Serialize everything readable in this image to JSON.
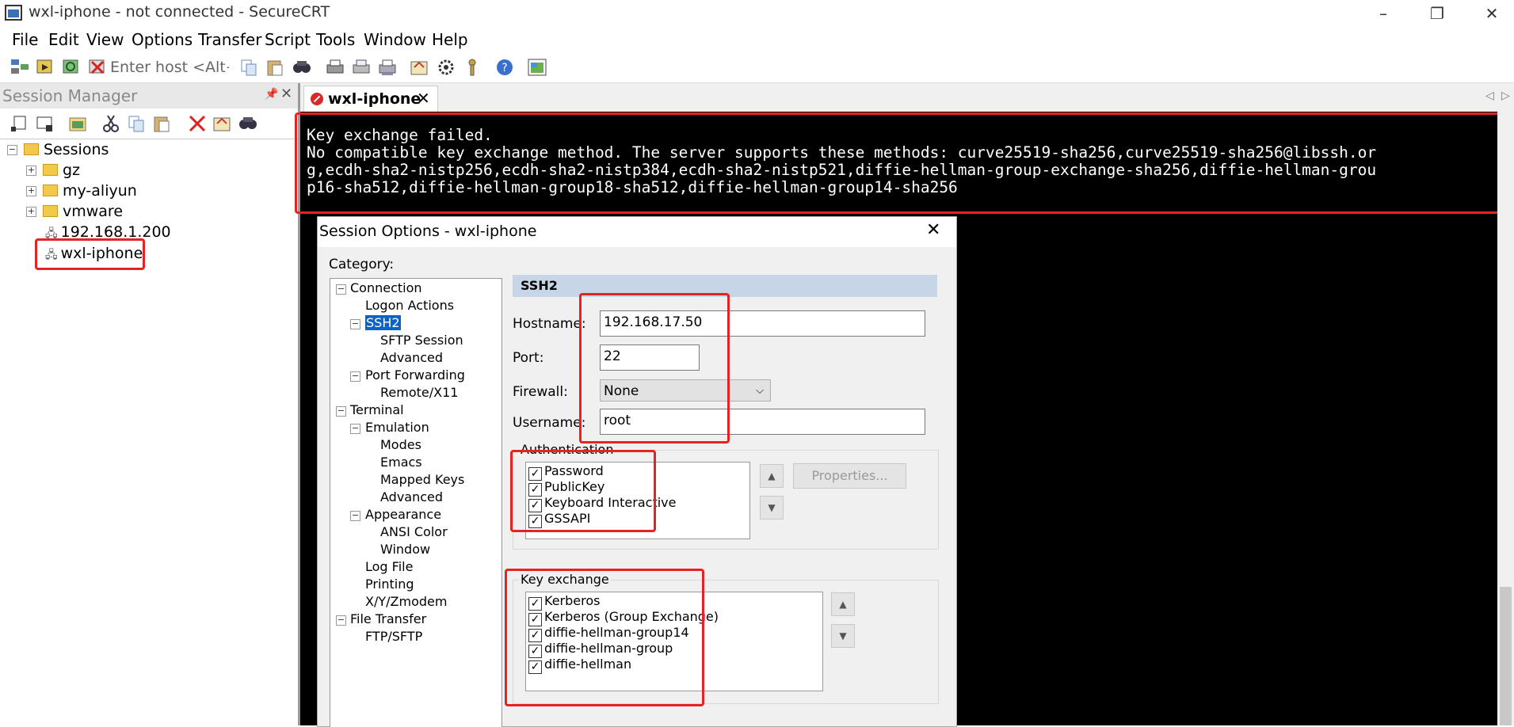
{
  "window": {
    "title": "wxl-iphone - not connected - SecureCRT"
  },
  "menu": [
    "File",
    "Edit",
    "View",
    "Options",
    "Transfer",
    "Script",
    "Tools",
    "Window",
    "Help"
  ],
  "toolbar": {
    "host_placeholder": "Enter host <Alt+"
  },
  "session_manager": {
    "title": "Session Manager",
    "tree": {
      "root": "Sessions",
      "folders": [
        "gz",
        "my-aliyun",
        "vmware"
      ],
      "sessions": [
        "192.168.1.200",
        "wxl-iphone"
      ]
    }
  },
  "tab": {
    "label": "wxl-iphone"
  },
  "terminal": {
    "lines": [
      "Key exchange failed.",
      "No compatible key exchange method. The server supports these methods: curve25519-sha256,curve25519-sha256@libssh.or",
      "g,ecdh-sha2-nistp256,ecdh-sha2-nistp384,ecdh-sha2-nistp521,diffie-hellman-group-exchange-sha256,diffie-hellman-grou",
      "p16-sha512,diffie-hellman-group18-sha512,diffie-hellman-group14-sha256"
    ]
  },
  "dialog": {
    "title": "Session Options - wxl-iphone",
    "category_label": "Category:",
    "categories": [
      "Connection",
      "Logon Actions",
      "SSH2",
      "SFTP Session",
      "Advanced",
      "Port Forwarding",
      "Remote/X11",
      "Terminal",
      "Emulation",
      "Modes",
      "Emacs",
      "Mapped Keys",
      "Advanced",
      "Appearance",
      "ANSI Color",
      "Window",
      "Log File",
      "Printing",
      "X/Y/Zmodem",
      "File Transfer",
      "FTP/SFTP"
    ],
    "section_title": "SSH2",
    "hostname_label": "Hostname:",
    "hostname_value": "192.168.17.50",
    "port_label": "Port:",
    "port_value": "22",
    "firewall_label": "Firewall:",
    "firewall_value": "None",
    "username_label": "Username:",
    "username_value": "root",
    "auth_label": "Authentication",
    "auth_methods": [
      "Password",
      "PublicKey",
      "Keyboard Interactive",
      "GSSAPI"
    ],
    "properties_button": "Properties...",
    "kex_label": "Key exchange",
    "kex_methods": [
      "Kerberos",
      "Kerberos (Group Exchange)",
      "diffie-hellman-group14",
      "diffie-hellman-group",
      "diffie-hellman"
    ]
  }
}
